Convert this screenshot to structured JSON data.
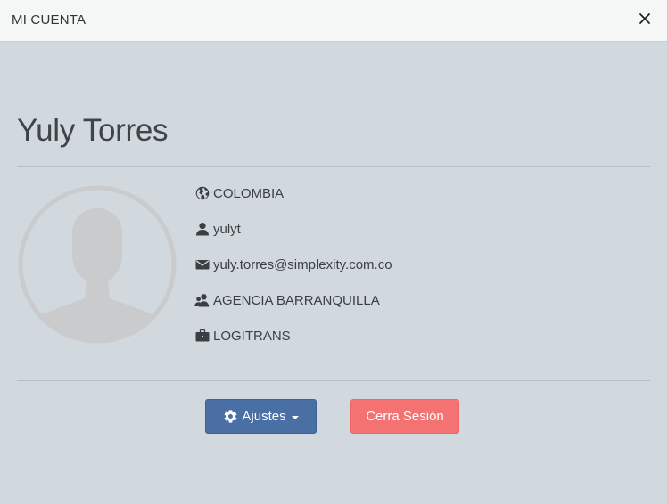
{
  "header": {
    "title": "MI CUENTA",
    "close_glyph": "✕"
  },
  "profile": {
    "name": "Yuly Torres",
    "avatar_icon": "user-silhouette-icon",
    "details": [
      {
        "icon": "globe-icon",
        "text": "COLOMBIA"
      },
      {
        "icon": "user-icon",
        "text": "yulyt"
      },
      {
        "icon": "envelope-icon",
        "text": "yuly.torres@simplexity.com.co"
      },
      {
        "icon": "users-icon",
        "text": "AGENCIA BARRANQUILLA"
      },
      {
        "icon": "briefcase-icon",
        "text": "LOGITRANS"
      }
    ]
  },
  "actions": {
    "settings_label": "Ajustes",
    "logout_label": "Cerra Sesión"
  },
  "colors": {
    "background": "#d1d8de",
    "header_bg": "#f5f6f6",
    "settings_btn": "#4a6fa5",
    "logout_btn": "#f47372",
    "avatar": "#c9cbcc"
  }
}
